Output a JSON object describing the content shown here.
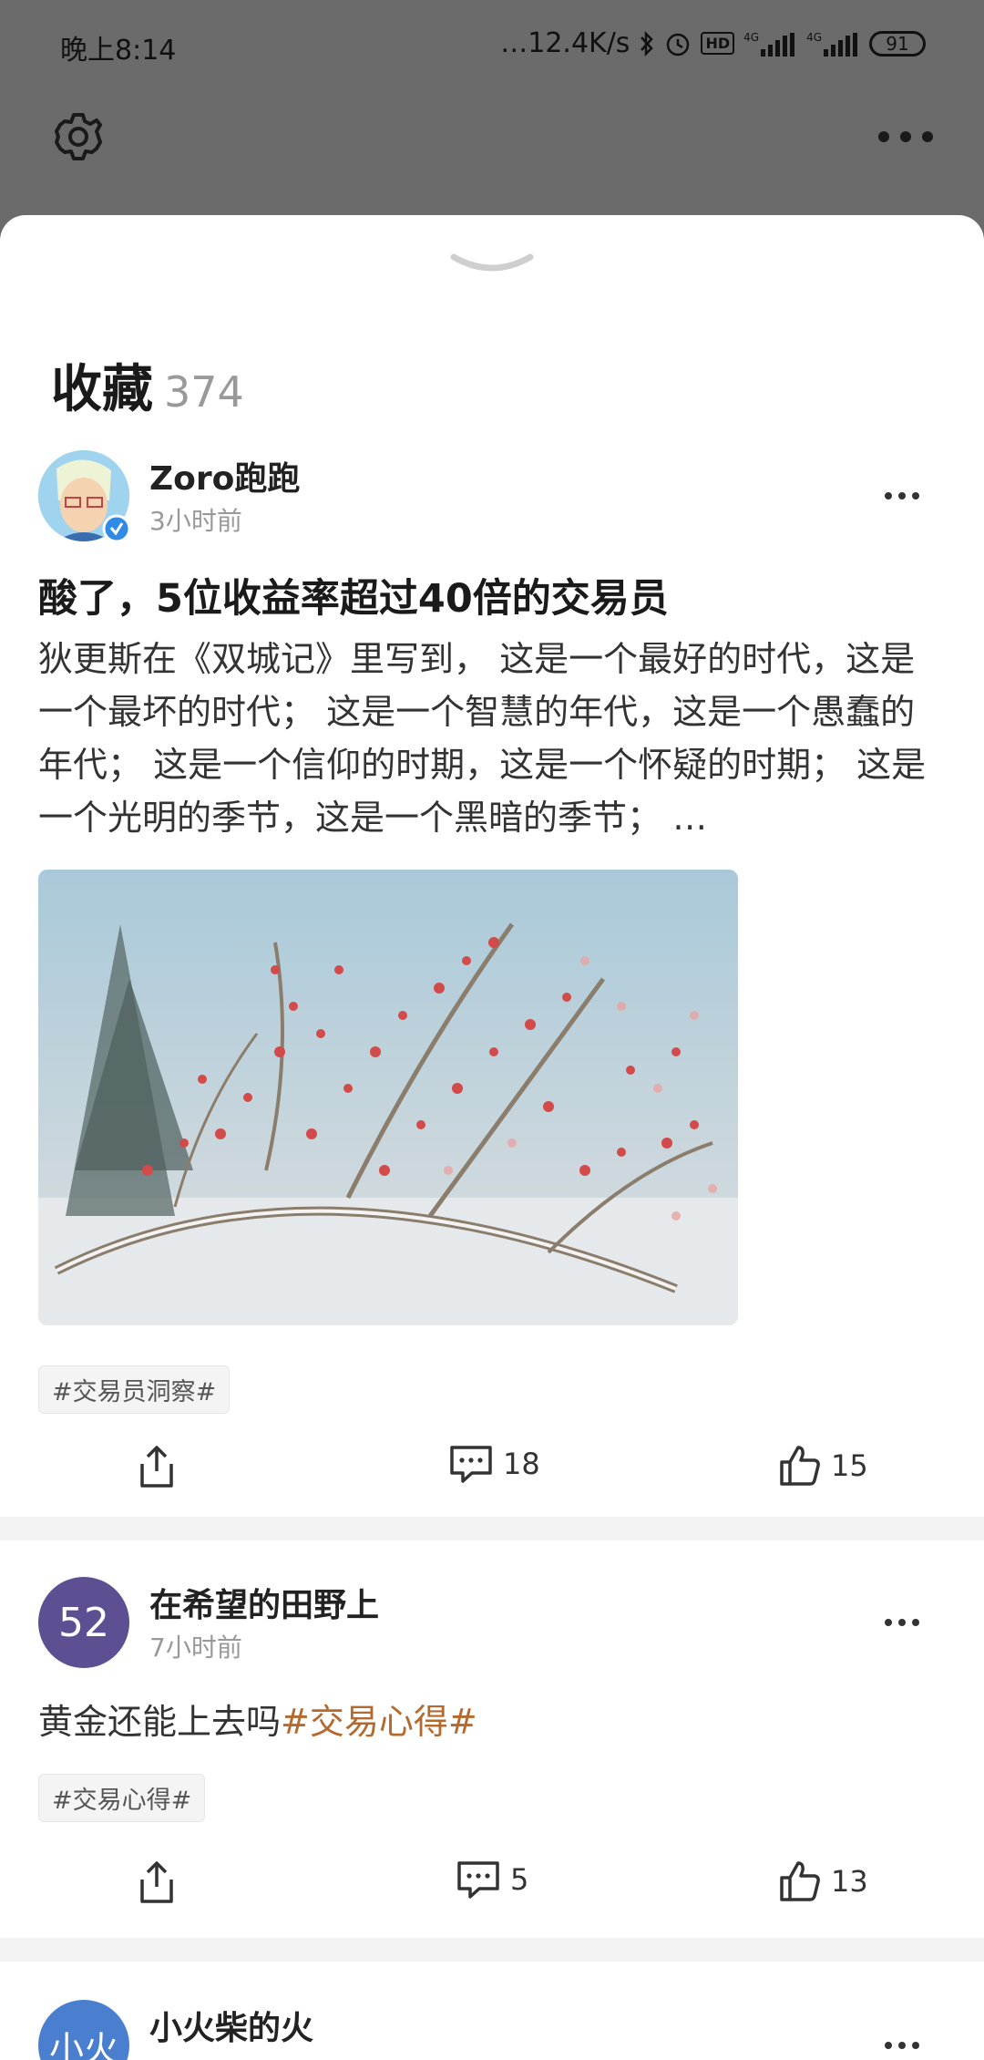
{
  "status_bar": {
    "time": "晚上8:14",
    "network_speed": "…12.4K/s",
    "net_label_1": "4G",
    "net_label_2": "4G",
    "hd_label": "HD",
    "battery": "91"
  },
  "top_bar": {
    "settings_icon": "gear-icon",
    "more_icon": "more-dots-icon"
  },
  "collection": {
    "title": "收藏",
    "count": "374"
  },
  "posts": [
    {
      "author": "Zoro跑跑",
      "time": "3小时前",
      "verified": true,
      "title": "酸了，5位收益率超过40倍的交易员",
      "body": "狄更斯在《双城记》里写到， 这是一个最好的时代，这是一个最坏的时代； 这是一个智慧的年代，这是一个愚蠢的年代； 这是一个信仰的时期，这是一个怀疑的时期； 这是一个光明的季节，这是一个黑暗的季节； …",
      "tag": "#交易员洞察#",
      "comments": "18",
      "likes": "15"
    },
    {
      "author": "在希望的田野上",
      "avatar_text": "52",
      "avatar_color": "#5e4f93",
      "time": "7小时前",
      "body": "黄金还能上去吗",
      "inline_tag": "#交易心得#",
      "tag": "#交易心得#",
      "comments": "5",
      "likes": "13"
    },
    {
      "author": "小火柴的火",
      "avatar_text": "小火",
      "avatar_color": "#4a7fcf"
    }
  ]
}
